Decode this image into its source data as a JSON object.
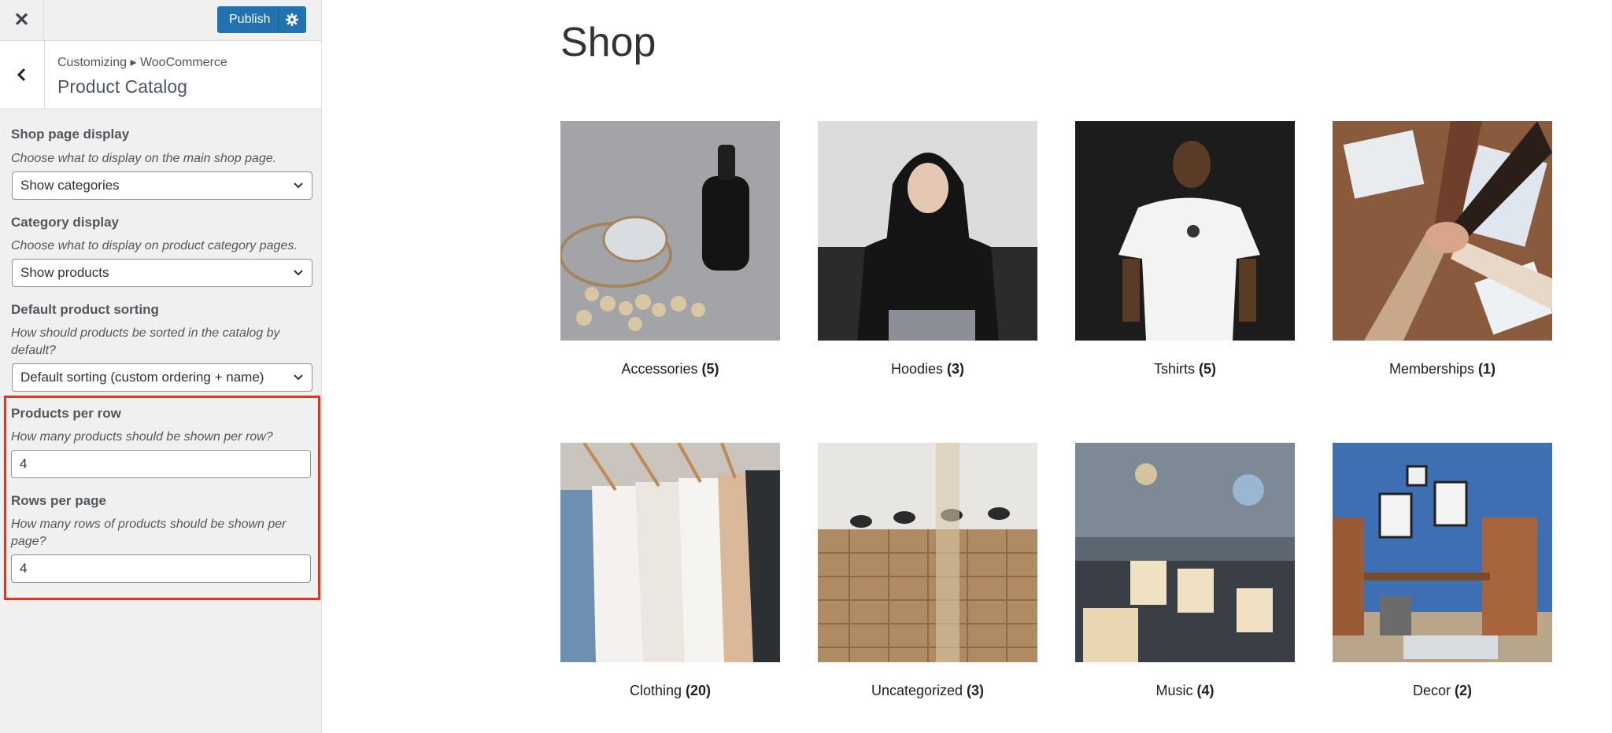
{
  "topbar": {
    "close_label": "✕",
    "publish_label": "Publish"
  },
  "section": {
    "breadcrumb": "Customizing ▸ WooCommerce",
    "title": "Product Catalog"
  },
  "controls": {
    "shop_display": {
      "title": "Shop page display",
      "desc": "Choose what to display on the main shop page.",
      "value": "Show categories"
    },
    "category_display": {
      "title": "Category display",
      "desc": "Choose what to display on product category pages.",
      "value": "Show products"
    },
    "sorting": {
      "title": "Default product sorting",
      "desc": "How should products be sorted in the catalog by default?",
      "value": "Default sorting (custom ordering + name)"
    },
    "per_row": {
      "title": "Products per row",
      "desc": "How many products should be shown per row?",
      "value": "4"
    },
    "rows_per_page": {
      "title": "Rows per page",
      "desc": "How many rows of products should be shown per page?",
      "value": "4"
    }
  },
  "preview": {
    "page_title": "Shop",
    "categories": [
      {
        "name": "Accessories",
        "count": "(5)"
      },
      {
        "name": "Hoodies",
        "count": "(3)"
      },
      {
        "name": "Tshirts",
        "count": "(5)"
      },
      {
        "name": "Memberships",
        "count": "(1)"
      },
      {
        "name": "Clothing",
        "count": "(20)"
      },
      {
        "name": "Uncategorized",
        "count": "(3)"
      },
      {
        "name": "Music",
        "count": "(4)"
      },
      {
        "name": "Decor",
        "count": "(2)"
      }
    ]
  },
  "colors": {
    "accent": "#2271b1",
    "highlight": "#e8321e",
    "sidebar_bg": "#f0f0f1"
  }
}
